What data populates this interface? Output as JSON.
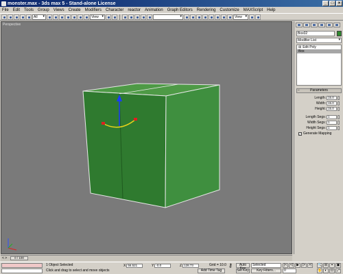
{
  "window": {
    "title": "monster.max - 3ds max 5 - Stand-alone License",
    "buttons": [
      "_",
      "□",
      "×"
    ]
  },
  "menu": [
    "File",
    "Edit",
    "Tools",
    "Group",
    "Views",
    "Create",
    "Modifiers",
    "Character",
    "reactor",
    "Animation",
    "Graph Editors",
    "Rendering",
    "Customize",
    "MAXScript",
    "Help"
  ],
  "toolbar": {
    "selection_filter": "All",
    "ref_coord": "View",
    "named_selection": "",
    "right_dropdown": "View"
  },
  "viewport": {
    "label": "Perspective",
    "object_color": "#3f8f3f"
  },
  "command_panel": {
    "object_name": "Box02",
    "object_color": "#2f8a2f",
    "modifier_list": "Modifier List",
    "stack": [
      {
        "label": "Edit Poly",
        "selected": false
      },
      {
        "label": "Box",
        "selected": true
      }
    ],
    "rollout_title": "Parameters",
    "params": [
      {
        "label": "Length:",
        "value": "15.0"
      },
      {
        "label": "Width:",
        "value": "15.0"
      },
      {
        "label": "Height:",
        "value": "15.0"
      },
      {
        "label": "Length Segs:",
        "value": "1"
      },
      {
        "label": "Width Segs:",
        "value": "1"
      },
      {
        "label": "Height Segs:",
        "value": "1"
      }
    ],
    "mapping_label": "Generate Mapping",
    "mapping_checked": true
  },
  "time_slider": {
    "frame_display": "0 / 100",
    "arrows": "<   >"
  },
  "status": {
    "selection": "1 Object Selected",
    "prompt": "Click and drag to select and move objects",
    "x_label": "X",
    "x_value": "56.521",
    "y_label": "Y",
    "y_value": "-0.0",
    "z_label": "Z",
    "z_value": "128.73",
    "grid": "Grid = 10.0",
    "add_time_tag": "Add Time Tag",
    "auto_key": "Auto Key",
    "set_key": "Set Key",
    "selected_dd": "Selected",
    "key_filters": "Key Filters...",
    "frame": "0",
    "play_buttons": [
      "|<",
      "<|",
      "▶",
      "|>",
      ">|"
    ],
    "nav_buttons": [
      "🔍",
      "⊞",
      "⌖",
      "▣",
      "✋",
      "◐",
      "⊡",
      "⤢"
    ]
  }
}
